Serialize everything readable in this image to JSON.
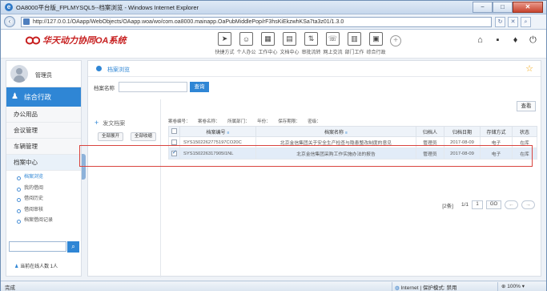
{
  "window": {
    "title": "OA8000平台版_FPLMYSQL5--档案浏览 - Windows Internet Explorer",
    "url": "http://127.0.0.1/OAapp/WebObjects/OAapp.woa/wo/com.oa8000.mainapp.OaPubMiddlePop/rF3hsKiEkzwhKSa7ta3z01/1.3.0",
    "minimize": "−",
    "maximize": "□",
    "close": "✕"
  },
  "header": {
    "logo_text": "华天动力协同OA系统",
    "tools": [
      {
        "label": "快捷方式",
        "icon": "paper-plane-icon",
        "glyph": "➤"
      },
      {
        "label": "个人办公",
        "icon": "person-card-icon",
        "glyph": "☺"
      },
      {
        "label": "工作中心",
        "icon": "grid-icon",
        "glyph": "▦"
      },
      {
        "label": "文档中心",
        "icon": "document-icon",
        "glyph": "▤"
      },
      {
        "label": "审批流转",
        "icon": "flow-icon",
        "glyph": "⇅"
      },
      {
        "label": "网上交流",
        "icon": "chat-icon",
        "glyph": "☏"
      },
      {
        "label": "部门工作",
        "icon": "department-icon",
        "glyph": "▥"
      },
      {
        "label": "综合行政",
        "icon": "building-icon",
        "glyph": "▣"
      }
    ],
    "add": "+",
    "right_icons": [
      {
        "name": "home-icon",
        "glyph": "⌂"
      },
      {
        "name": "apps-grid-icon",
        "glyph": "▪"
      },
      {
        "name": "shirt-skin-icon",
        "glyph": "♦"
      },
      {
        "name": "power-icon",
        "glyph": "⏻"
      }
    ]
  },
  "sidebar": {
    "user_name": "管理员",
    "module": "综合行政",
    "menu": [
      "办公用品",
      "会议管理",
      "车辆管理",
      "档案中心"
    ],
    "sub_items": [
      "档案浏览",
      "我的借阅",
      "借阅历史",
      "借阅审核",
      "档案借阅记录"
    ],
    "online": "当前在线人数 1人"
  },
  "content": {
    "breadcrumb": "档案浏览",
    "search_label": "档案名称",
    "search_value": "",
    "query_button": "查询",
    "tree_title": "发文档案",
    "expand_all": "全部展开",
    "collapse_all": "全部收缩",
    "view_button": "查看",
    "filters": [
      "案卷编号：",
      "案卷名称：",
      "所属部门：",
      "年份：",
      "保存期限：",
      "密级："
    ],
    "columns": [
      "",
      "档案编号",
      "档案名称",
      "归档人",
      "归档日期",
      "存储方式",
      "状态"
    ],
    "rows": [
      {
        "checked": false,
        "id": "SYS1502262775197CO20C",
        "name": "北京金信集团关于安全生产检查与隐患整改制度的意见",
        "person": "管理员",
        "date": "2017-08-09",
        "storage": "电子",
        "status": "在库"
      },
      {
        "checked": true,
        "id": "SYS150226317905I1NL",
        "name": "北京金信集团采购工作实施办法的报告",
        "person": "管理员",
        "date": "2017-08-09",
        "storage": "电子",
        "status": "在库"
      }
    ],
    "pager": {
      "total": "[2条]",
      "pages": "1/1",
      "page_input": "1",
      "go": "GO",
      "prev": "←",
      "next": "→"
    }
  },
  "statusbar": {
    "left": "完成",
    "zone": "Internet | 保护模式: 禁用",
    "zoom": "100%"
  }
}
